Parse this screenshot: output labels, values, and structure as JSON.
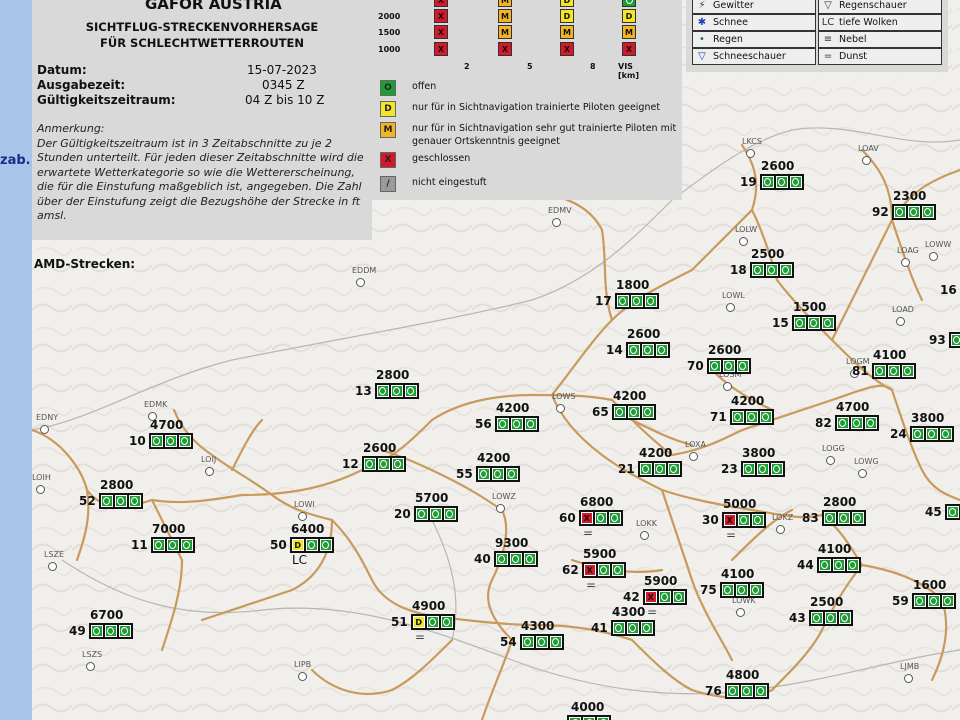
{
  "page": {
    "side_label": "zab.)",
    "title": "GAFOR AUSTRIA",
    "subtitle_1": "SICHTFLUG-STRECKENVORHERSAGE",
    "subtitle_2": "FÜR SCHLECHTWETTERROUTEN",
    "date_label": "Datum:",
    "date_value": "15-07-2023",
    "issue_label": "Ausgabezeit:",
    "issue_value": "0345 Z",
    "validity_label": "Gültigkeitszeitraum:",
    "validity_value": "04 Z bis 10 Z",
    "note_title": "Anmerkung:",
    "note_text": "Der Gültigkeitszeitraum ist in 3 Zeitabschnitte zu je 2 Stunden unterteilt. Für jeden dieser Zeitabschnitte wird die erwartete Wetterkategorie so wie die Wettererscheinung, die für die Einstufung maßgeblich ist, angegeben. Die Zahl über der Einstufung zeigt die Bezugshöhe der Strecke in ft amsl.",
    "amd_label": "AMD-Strecken:"
  },
  "vis_table": {
    "heights": [
      "2000",
      "1500",
      "1000"
    ],
    "rows": [
      [
        "X",
        "M",
        "D",
        "O"
      ],
      [
        "X",
        "M",
        "D",
        "D"
      ],
      [
        "X",
        "M",
        "M",
        "M"
      ],
      [
        "X",
        "X",
        "X",
        "X"
      ]
    ],
    "x_labels": [
      "2",
      "5",
      "8",
      "VIS [km]"
    ]
  },
  "legend": [
    {
      "code": "O",
      "color": "#1f9d35",
      "text": "offen"
    },
    {
      "code": "D",
      "color": "#f3e62a",
      "text": "nur für in Sichtnavigation trainierte Piloten geeignet"
    },
    {
      "code": "M",
      "color": "#f2b325",
      "text": "nur für in Sichtnavigation sehr gut trainierte Piloten mit genauer Ortskenntnis geeignet"
    },
    {
      "code": "X",
      "color": "#d11a2a",
      "text": "geschlossen"
    },
    {
      "code": "/",
      "color": "#9a9a9a",
      "text": "nicht eingestuft"
    }
  ],
  "weather_legend": {
    "left": [
      {
        "icon": "thunder-icon",
        "glyph": "⚡",
        "text": "Gewitter"
      },
      {
        "icon": "snow-icon",
        "glyph": "✱",
        "text": "Schnee"
      },
      {
        "icon": "rain-icon",
        "glyph": "•",
        "text": "Regen"
      },
      {
        "icon": "snow-shower-icon",
        "glyph": "▽",
        "text": "Schneeschauer"
      }
    ],
    "right": [
      {
        "icon": "rain-shower-icon",
        "glyph": "▽",
        "text": "Regenschauer"
      },
      {
        "icon": "low-cloud-icon",
        "glyph": "LC",
        "text": "tiefe Wolken"
      },
      {
        "icon": "fog-icon",
        "glyph": "≡",
        "text": "Nebel"
      },
      {
        "icon": "haze-icon",
        "glyph": "=",
        "text": "Dunst"
      }
    ]
  },
  "airports": [
    "LKCS",
    "LOAV",
    "EDMV",
    "LOLW",
    "LOWL",
    "EDDM",
    "LOAG",
    "LOAD",
    "EDMK",
    "LOWS",
    "LOGM",
    "LOSM",
    "LOXA",
    "LOIJ",
    "LOIH",
    "LOWI",
    "LOWZ",
    "LOGG",
    "LOKK",
    "LOWK",
    "LOKZ",
    "LOWG",
    "LSZS",
    "LIPB",
    "LOWW",
    "LJMB",
    "LSZE",
    "EDNY"
  ],
  "routes": [
    {
      "id": "19",
      "alt": "2600",
      "c": [
        "O",
        "O",
        "O"
      ]
    },
    {
      "id": "92",
      "alt": "2300",
      "c": [
        "O",
        "O",
        "O"
      ]
    },
    {
      "id": "18",
      "alt": "2500",
      "c": [
        "O",
        "O",
        "O"
      ]
    },
    {
      "id": "16",
      "alt": "",
      "c": [
        "O"
      ]
    },
    {
      "id": "17",
      "alt": "1800",
      "c": [
        "O",
        "O",
        "O"
      ]
    },
    {
      "id": "15",
      "alt": "1500",
      "c": [
        "O",
        "O",
        "O"
      ]
    },
    {
      "id": "93",
      "alt": "",
      "c": [
        "O"
      ]
    },
    {
      "id": "14",
      "alt": "2600",
      "c": [
        "O",
        "O",
        "O"
      ]
    },
    {
      "id": "70",
      "alt": "2600",
      "c": [
        "O",
        "O",
        "O"
      ]
    },
    {
      "id": "81",
      "alt": "4100",
      "c": [
        "O",
        "O",
        "O"
      ]
    },
    {
      "id": "13",
      "alt": "2800",
      "c": [
        "O",
        "O",
        "O"
      ]
    },
    {
      "id": "56",
      "alt": "4200",
      "c": [
        "O",
        "O",
        "O"
      ]
    },
    {
      "id": "65",
      "alt": "4200",
      "c": [
        "O",
        "O",
        "O"
      ]
    },
    {
      "id": "71",
      "alt": "4200",
      "c": [
        "O",
        "O",
        "O"
      ]
    },
    {
      "id": "82",
      "alt": "4700",
      "c": [
        "O",
        "O",
        "O"
      ]
    },
    {
      "id": "24",
      "alt": "3800",
      "c": [
        "O",
        "O",
        "O"
      ]
    },
    {
      "id": "10",
      "alt": "4700",
      "c": [
        "O",
        "O",
        "O"
      ]
    },
    {
      "id": "12",
      "alt": "2600",
      "c": [
        "O",
        "O",
        "O"
      ]
    },
    {
      "id": "55",
      "alt": "4200",
      "c": [
        "O",
        "O",
        "O"
      ]
    },
    {
      "id": "21",
      "alt": "4200",
      "c": [
        "O",
        "O",
        "O"
      ]
    },
    {
      "id": "23",
      "alt": "3800",
      "c": [
        "O",
        "O",
        "O"
      ]
    },
    {
      "id": "52",
      "alt": "2800",
      "c": [
        "O",
        "O",
        "O"
      ]
    },
    {
      "id": "20",
      "alt": "5700",
      "c": [
        "O",
        "O",
        "O"
      ]
    },
    {
      "id": "60",
      "alt": "6800",
      "c": [
        "X",
        "O",
        "O"
      ],
      "sym": "="
    },
    {
      "id": "30",
      "alt": "5000",
      "c": [
        "X",
        "O",
        "O"
      ],
      "sym": "="
    },
    {
      "id": "83",
      "alt": "2800",
      "c": [
        "O",
        "O",
        "O"
      ]
    },
    {
      "id": "45",
      "alt": "",
      "c": [
        "O",
        "O"
      ]
    },
    {
      "id": "11",
      "alt": "7000",
      "c": [
        "O",
        "O",
        "O"
      ]
    },
    {
      "id": "50",
      "alt": "6400",
      "c": [
        "D",
        "O",
        "O"
      ],
      "sub": "LC"
    },
    {
      "id": "40",
      "alt": "9300",
      "c": [
        "O",
        "O",
        "O"
      ]
    },
    {
      "id": "62",
      "alt": "5900",
      "c": [
        "X",
        "O",
        "O"
      ],
      "sym": "="
    },
    {
      "id": "44",
      "alt": "4100",
      "c": [
        "O",
        "O",
        "O"
      ]
    },
    {
      "id": "42",
      "alt": "5900",
      "c": [
        "X",
        "O",
        "O"
      ],
      "sym": "="
    },
    {
      "id": "75",
      "alt": "4100",
      "c": [
        "O",
        "O",
        "O"
      ]
    },
    {
      "id": "59",
      "alt": "1600",
      "c": [
        "O",
        "O",
        "O"
      ]
    },
    {
      "id": "49",
      "alt": "6700",
      "c": [
        "O",
        "O",
        "O"
      ]
    },
    {
      "id": "51",
      "alt": "4900",
      "c": [
        "D",
        "O",
        "O"
      ],
      "sym": "="
    },
    {
      "id": "54",
      "alt": "4300",
      "c": [
        "O",
        "O",
        "O"
      ]
    },
    {
      "id": "41",
      "alt": "4300",
      "c": [
        "O",
        "O",
        "O"
      ]
    },
    {
      "id": "43",
      "alt": "2500",
      "c": [
        "O",
        "O",
        "O"
      ]
    },
    {
      "id": "76",
      "alt": "4800",
      "c": [
        "O",
        "O",
        "O"
      ]
    },
    {
      "id": "",
      "alt": "4000",
      "c": [
        "O",
        "O",
        "O"
      ]
    }
  ]
}
